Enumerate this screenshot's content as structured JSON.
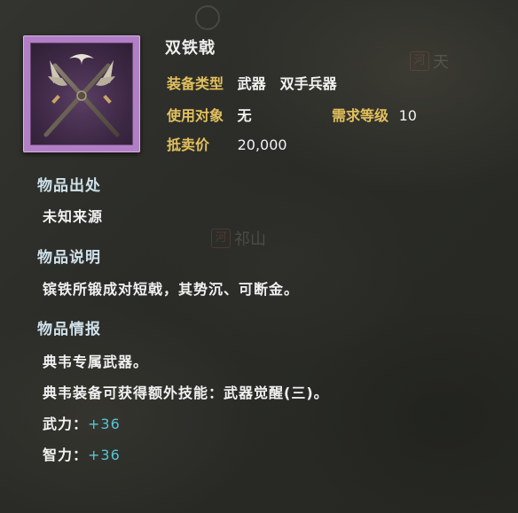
{
  "item": {
    "name": "双铁戟",
    "info": [
      {
        "label": "装备类型",
        "value": "武器　双手兵器"
      },
      {
        "label": "使用对象",
        "value": "无"
      },
      {
        "label": "需求等级",
        "value": "10"
      },
      {
        "label": "抵卖价",
        "value": "20,000"
      }
    ]
  },
  "sections": {
    "origin": {
      "title": "物品出处",
      "text": "未知来源"
    },
    "description": {
      "title": "物品说明",
      "text": "镔铁所锻成对短戟，其势沉、可断金。"
    },
    "details": {
      "title": "物品情报",
      "lines": [
        "典韦专属武器。",
        "典韦装备可获得额外技能：武器觉醒(三)。"
      ],
      "stats": [
        {
          "label": "武力：",
          "value": "+36"
        },
        {
          "label": "智力：",
          "value": "+36"
        }
      ]
    }
  },
  "background": {
    "mark1": {
      "seal": "河",
      "text": "天"
    },
    "mark2": {
      "seal": "河",
      "text": "祁山"
    }
  },
  "colors": {
    "label_gold": "#e2c05c",
    "stat_cyan": "#55c4d8",
    "rarity_purple": "#b27fc6"
  },
  "icons": {
    "item": "crossed-halberds-icon"
  }
}
